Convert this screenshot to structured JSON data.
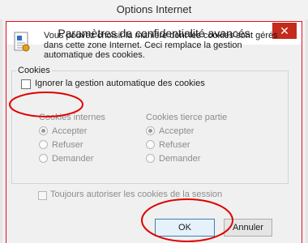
{
  "outer_window": {
    "title": "Options Internet"
  },
  "dialog": {
    "title": "Paramètres de confidentialité avancés",
    "close_glyph": "✕",
    "info_text": "Vous pouvez choisir la manière dont les cookies sont gérés dans cette zone Internet. Ceci remplace la gestion automatique des cookies.",
    "group_label": "Cookies",
    "override_label": "Ignorer la gestion automatique des cookies",
    "override_checked": false,
    "first_party": {
      "title": "Cookies internes",
      "options": [
        "Accepter",
        "Refuser",
        "Demander"
      ],
      "selected": "Accepter"
    },
    "third_party": {
      "title": "Cookies tierce partie",
      "options": [
        "Accepter",
        "Refuser",
        "Demander"
      ],
      "selected": "Accepter"
    },
    "session_label": "Toujours autoriser les cookies de la session",
    "session_checked": false,
    "ok_label": "OK",
    "cancel_label": "Annuler"
  },
  "colors": {
    "close_button": "#c42b1c",
    "annotation_red": "#e00000",
    "disabled_text": "#8c8c8c"
  },
  "icons": [
    "privacy-document-icon",
    "close-icon"
  ]
}
